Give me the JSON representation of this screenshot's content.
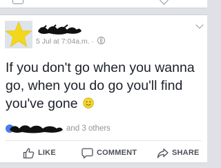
{
  "post": {
    "timestamp": "5 Jul at 7:04a.m.",
    "separator": "·",
    "privacy_icon": "globe-icon",
    "text": "If you don't go when you wanna go, when you do go you'll find you've gone",
    "emoji": "smiley-emoji",
    "reactions": {
      "icon": "like-badge-icon",
      "others": "and 3 others"
    }
  },
  "actions": {
    "like": "LIKE",
    "comment": "COMMENT",
    "share": "SHARE"
  },
  "colors": {
    "accent": "#4c7ce8",
    "text": "#1d2129",
    "muted": "#90949c",
    "star": "#f3d71a"
  }
}
